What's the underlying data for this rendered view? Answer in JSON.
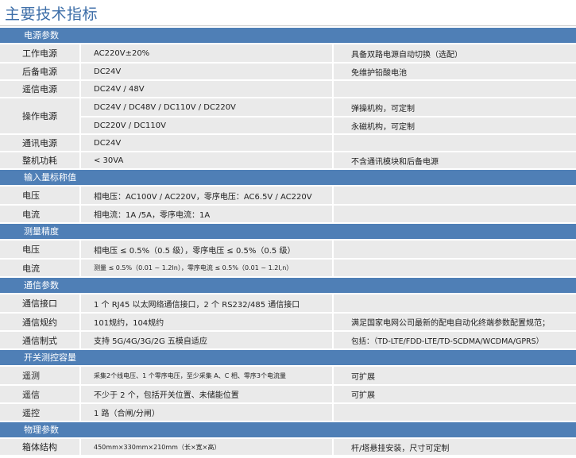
{
  "title": "主要技术指标",
  "sections": [
    {
      "title": "电源参数"
    },
    {
      "title": "输入量标称值"
    },
    {
      "title": "测量精度"
    },
    {
      "title": "通信参数"
    },
    {
      "title": "开关测控容量"
    },
    {
      "title": "物理参数"
    }
  ],
  "rows": {
    "work_power": {
      "label": "工作电源",
      "value": "AC220V±20%",
      "note": "具备双路电源自动切换（选配）"
    },
    "backup_power": {
      "label": "后备电源",
      "value": "DC24V",
      "note": "免维护铅酸电池"
    },
    "remote_signal_power": {
      "label": "遥信电源",
      "value": "DC24V / 48V",
      "note": ""
    },
    "operating_power": {
      "label": "操作电源",
      "values": [
        "DC24V / DC48V / DC110V / DC220V",
        "DC220V / DC110V"
      ],
      "notes": [
        "弹操机构，可定制",
        "永磁机构，可定制"
      ]
    },
    "comm_power": {
      "label": "通讯电源",
      "value": "DC24V",
      "note": ""
    },
    "power_consumption": {
      "label": "整机功耗",
      "value": "< 30VA",
      "note": "不含通讯模块和后备电源"
    },
    "voltage": {
      "label": "电压",
      "value": "相电压：AC100V / AC220V，零序电压：AC6.5V / AC220V",
      "note": ""
    },
    "current": {
      "label": "电流",
      "value": "相电流：1A /5A，零序电流：1A",
      "note": ""
    },
    "voltage_accuracy": {
      "label": "电压",
      "value": "相电压 ≤ 0.5%（0.5 级），零序电压 ≤ 0.5%（0.5 级）",
      "note": ""
    },
    "current_accuracy": {
      "label": "电流",
      "value": "测量 ≤ 0.5%（0.01 ~ 1.2In），零序电流 ≤ 0.5%（0.01 ~ 1.2I,n）",
      "note": ""
    },
    "comm_interface": {
      "label": "通信接口",
      "value": "1 个 RJ45 以太网络通信接口，2 个 RS232/485 通信接口",
      "note": ""
    },
    "comm_protocol": {
      "label": "通信规约",
      "value": "101规约，104规约",
      "note": "满足国家电网公司最新的配电自动化终端参数配置规范；"
    },
    "comm_mode": {
      "label": "通信制式",
      "value": "支持 5G/4G/3G/2G 五模自适应",
      "note": "包括：（TD-LTE/FDD-LTE/TD-SCDMA/WCDMA/GPRS）"
    },
    "telemetry": {
      "label": "遥测",
      "value": "采集2个线电压、1 个零序电压，至少采集 A、C 相、零序3个电流量",
      "note": "可扩展"
    },
    "telesignal": {
      "label": "遥信",
      "value": "不少于 2 个，包括开关位置、未储能位置",
      "note": "可扩展"
    },
    "telecontrol": {
      "label": "遥控",
      "value": "1 路（合闸/分闸）",
      "note": ""
    },
    "cabinet": {
      "label": "箱体结构",
      "value": "450mm×330mm×210mm（长×宽×高）",
      "note": "杆/塔悬挂安装，尺寸可定制"
    }
  }
}
